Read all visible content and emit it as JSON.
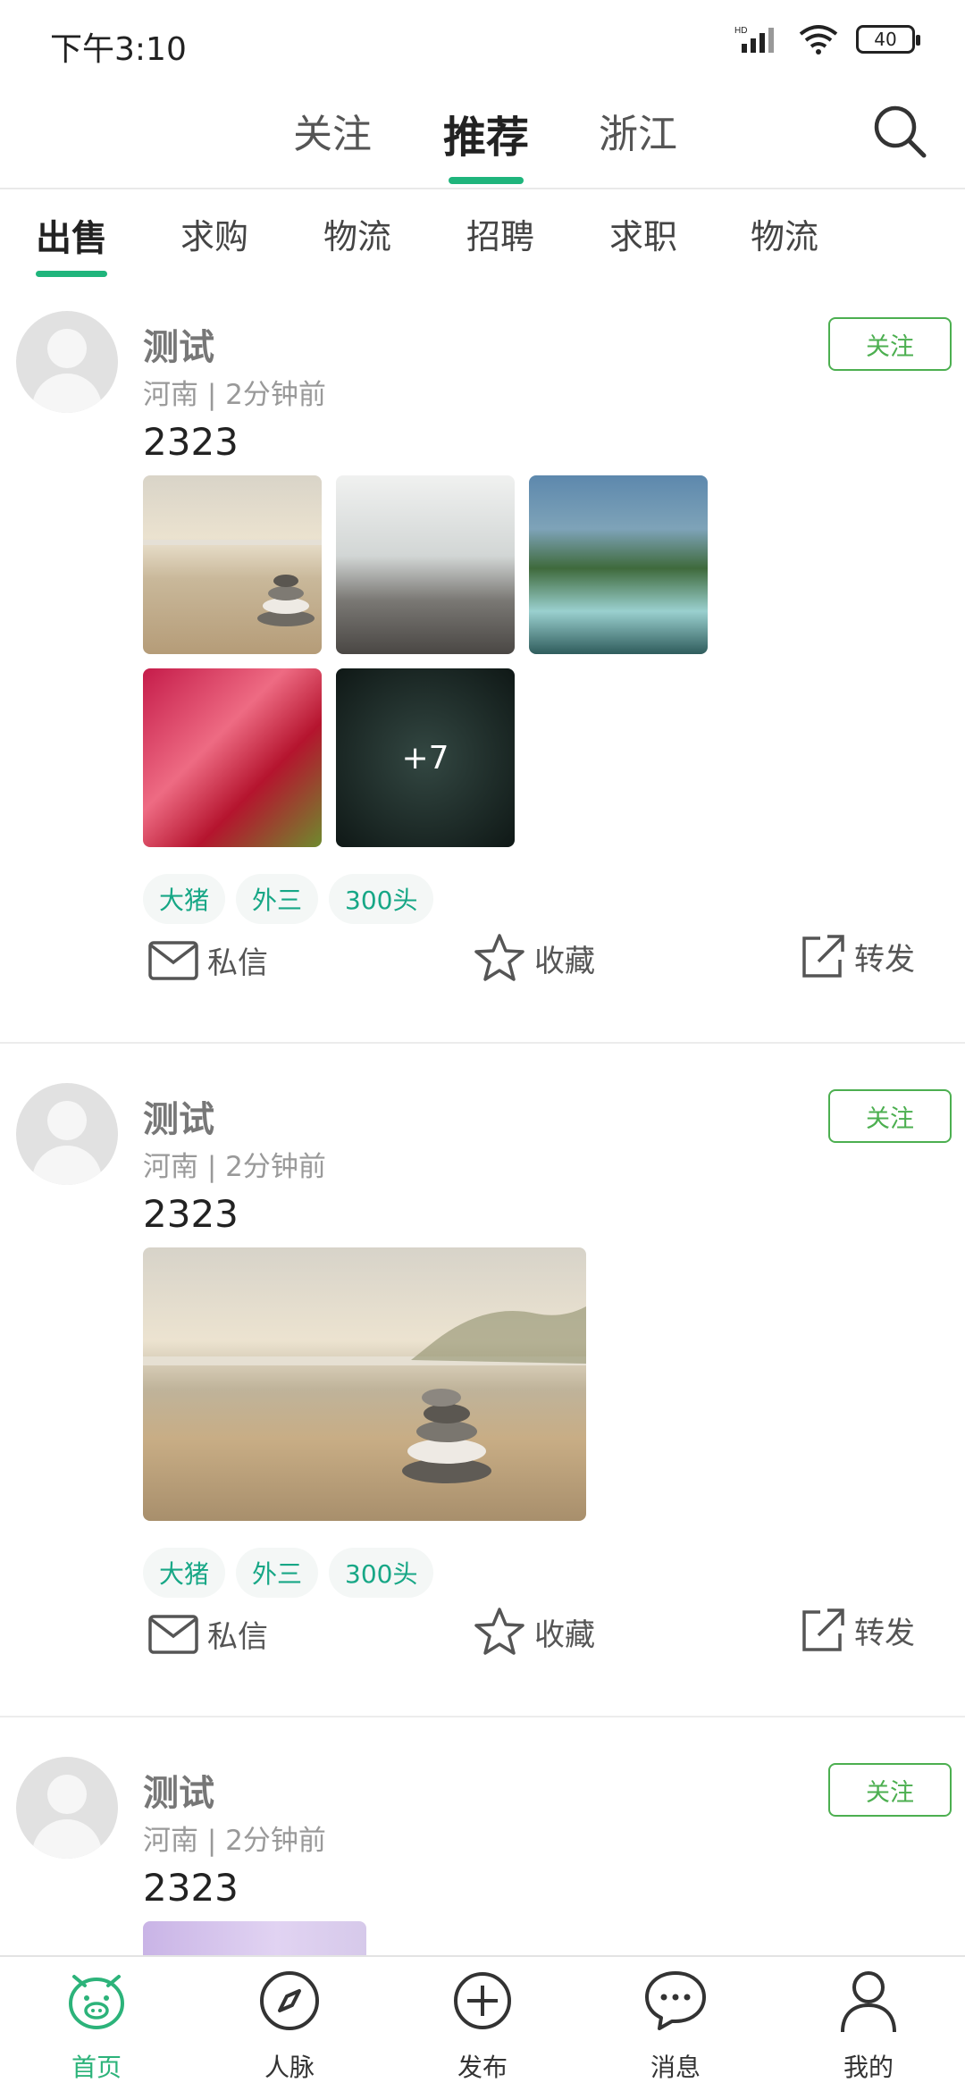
{
  "status_bar": {
    "time": "下午3:10",
    "battery": "40"
  },
  "top_tabs": [
    {
      "label": "关注",
      "active": false
    },
    {
      "label": "推荐",
      "active": true
    },
    {
      "label": "浙江",
      "active": false
    }
  ],
  "categories": [
    {
      "label": "出售",
      "active": true
    },
    {
      "label": "求购",
      "active": false
    },
    {
      "label": "物流",
      "active": false
    },
    {
      "label": "招聘",
      "active": false
    },
    {
      "label": "求职",
      "active": false
    },
    {
      "label": "物流",
      "active": false
    }
  ],
  "posts": [
    {
      "username": "测试",
      "meta": "河南 | 2分钟前",
      "content": "2323",
      "follow_label": "关注",
      "more_count": "+7",
      "tags": [
        "大猪",
        "外三",
        "300头"
      ],
      "actions": {
        "message": "私信",
        "favorite": "收藏",
        "share": "转发"
      }
    },
    {
      "username": "测试",
      "meta": "河南 | 2分钟前",
      "content": "2323",
      "follow_label": "关注",
      "tags": [
        "大猪",
        "外三",
        "300头"
      ],
      "actions": {
        "message": "私信",
        "favorite": "收藏",
        "share": "转发"
      }
    },
    {
      "username": "测试",
      "meta": "河南 | 2分钟前",
      "content": "2323",
      "follow_label": "关注"
    }
  ],
  "bottom_nav": [
    {
      "label": "首页",
      "icon": "pig-home-icon",
      "active": true
    },
    {
      "label": "人脉",
      "icon": "compass-icon",
      "active": false
    },
    {
      "label": "发布",
      "icon": "plus-circle-icon",
      "active": false
    },
    {
      "label": "消息",
      "icon": "chat-bubble-icon",
      "active": false
    },
    {
      "label": "我的",
      "icon": "user-icon",
      "active": false
    }
  ],
  "colors": {
    "accent": "#1fb57c",
    "follow": "#4caf50",
    "tag_text": "#17a786"
  }
}
